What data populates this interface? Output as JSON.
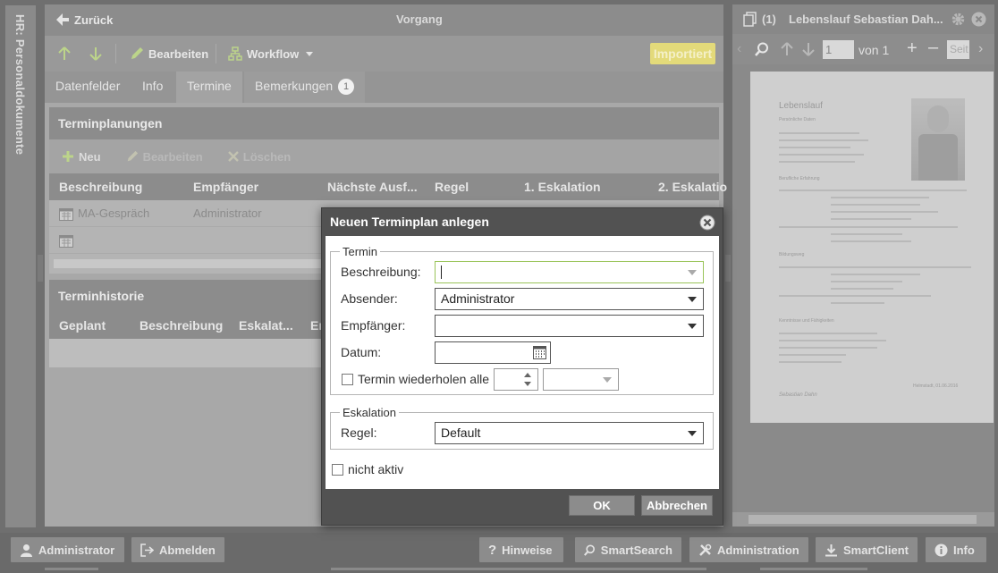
{
  "left_rail": {
    "label": "HR: Personaldokumente"
  },
  "topbar": {
    "back_label": "Zurück",
    "title": "Vorgang"
  },
  "toolbar": {
    "edit_label": "Bearbeiten",
    "workflow_label": "Workflow",
    "imported_label": "Importiert"
  },
  "tabs": [
    {
      "label": "Datenfelder"
    },
    {
      "label": "Info"
    },
    {
      "label": "Termine"
    },
    {
      "label": "Bemerkungen",
      "badge": "1"
    }
  ],
  "terminplanungen": {
    "title": "Terminplanungen",
    "tools": {
      "new": "Neu",
      "edit": "Bearbeiten",
      "delete": "Löschen"
    },
    "columns": [
      "Beschreibung",
      "Empfänger",
      "Nächste Ausf...",
      "Regel",
      "1. Eskalation",
      "2. Eskalatio"
    ],
    "rows": [
      {
        "beschreibung": "MA-Gespräch",
        "empfaenger": "Administrator"
      },
      {
        "beschreibung": "",
        "empfaenger": ""
      }
    ]
  },
  "terminhistorie": {
    "title": "Terminhistorie",
    "columns": [
      "Geplant",
      "Beschreibung",
      "Eskalat...",
      "Er"
    ]
  },
  "right_panel": {
    "count": "(1)",
    "title": "Lebenslauf Sebastian Dah...",
    "page_value": "1",
    "page_of": "von 1",
    "zoom_placeholder": "Seit"
  },
  "pdf": {
    "heading": "Lebenslauf",
    "sections": [
      "Persönliche Daten",
      "Berufliche Erfahrung",
      "Bildungsweg",
      "Kenntnisse und Fähigkeiten"
    ],
    "signature": "Sebastian Dahn",
    "footer": "Helmstadt, 01.06.2016"
  },
  "bottombar": {
    "user": "Administrator",
    "logout": "Abmelden",
    "hints": "Hinweise",
    "smartsearch": "SmartSearch",
    "administration": "Administration",
    "smartclient": "SmartClient",
    "info": "Info"
  },
  "dialog": {
    "title": "Neuen Terminplan anlegen",
    "group_termin": "Termin",
    "label_beschreibung": "Beschreibung:",
    "value_beschreibung": "",
    "label_absender": "Absender:",
    "value_absender": "Administrator",
    "label_empfaenger": "Empfänger:",
    "value_empfaenger": "",
    "label_datum": "Datum:",
    "value_datum": "",
    "repeat_label": "Termin wiederholen alle",
    "group_eskalation": "Eskalation",
    "label_regel": "Regel:",
    "value_regel": "Default",
    "inactive_label": "nicht aktiv",
    "ok": "OK",
    "cancel": "Abbrechen"
  },
  "colors": {
    "overlay": "#6f6f6f",
    "dialog_frame": "#525252",
    "focus_border": "#9ac45a",
    "imported_badge": "#e3da7a"
  }
}
